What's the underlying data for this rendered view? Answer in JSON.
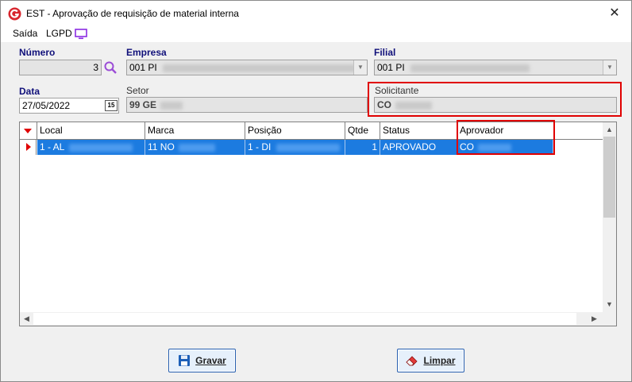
{
  "window": {
    "title": "EST - Aprovação de requisição de material interna",
    "close_symbol": "✕"
  },
  "menu": {
    "items": [
      "Saída",
      "LGPD"
    ],
    "icon": "monitor-icon"
  },
  "form": {
    "numero_label": "Número",
    "numero_value": "3",
    "empresa_label": "Empresa",
    "empresa_value": "001 PI",
    "filial_label": "Filial",
    "filial_value": "001 PI",
    "data_label": "Data",
    "data_value": "27/05/2022",
    "calendar_label": "15",
    "setor_label": "Setor",
    "setor_value": "99   GE",
    "solicitante_label": "Solicitante",
    "solicitante_value": "CO"
  },
  "grid": {
    "columns": [
      "Local",
      "Marca",
      "Posição",
      "Qtde",
      "Status",
      "Aprovador"
    ],
    "rows": [
      {
        "local": "1 - AL",
        "marca": "11   NO",
        "posicao": "1 - DI",
        "qtde": "1",
        "status": "APROVADO",
        "aprovador": "CO"
      }
    ]
  },
  "buttons": {
    "gravar": "Gravar",
    "limpar": "Limpar"
  },
  "colors": {
    "accent_label": "#10107a",
    "selection": "#1c7be0",
    "highlight_box": "#e00000"
  }
}
